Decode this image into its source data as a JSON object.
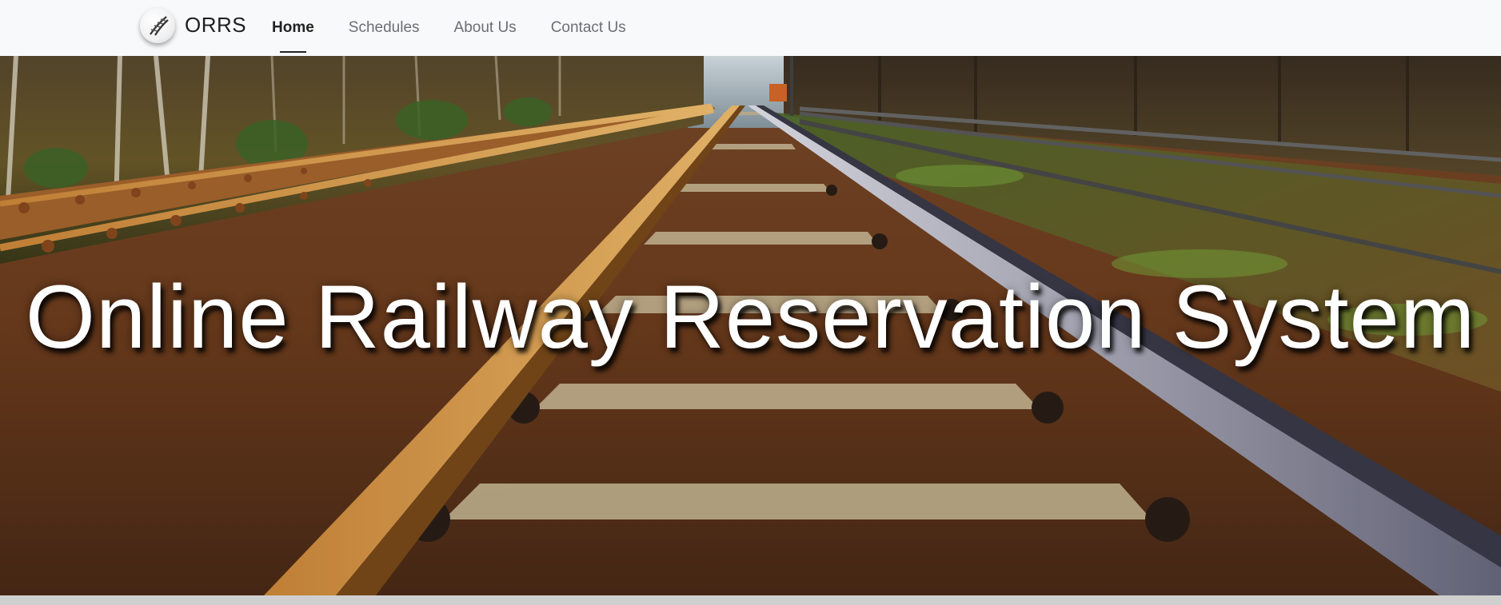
{
  "brand": {
    "name": "ORRS",
    "logo_icon": "railway-track-logo-icon"
  },
  "nav": {
    "items": [
      {
        "label": "Home",
        "active": true
      },
      {
        "label": "Schedules",
        "active": false
      },
      {
        "label": "About Us",
        "active": false
      },
      {
        "label": "Contact Us",
        "active": false
      }
    ]
  },
  "hero": {
    "title": "Online Railway Reservation System",
    "background": "railway-tracks-photo"
  },
  "colors": {
    "navbar_bg": "#f8f9fb",
    "active_link": "#222222",
    "inactive_link": "#6c6f73",
    "hero_text": "#ffffff"
  }
}
